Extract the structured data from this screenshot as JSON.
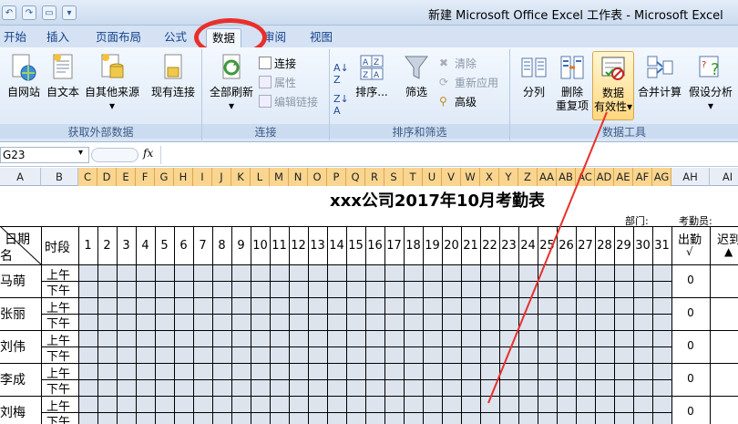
{
  "window": {
    "title": "新建 Microsoft Office Excel 工作表 - Microsoft Excel"
  },
  "tabs": [
    {
      "label": "开始",
      "active": false
    },
    {
      "label": "插入",
      "active": false
    },
    {
      "label": "页面布局",
      "active": false
    },
    {
      "label": "公式",
      "active": false
    },
    {
      "label": "数据",
      "active": true
    },
    {
      "label": "审阅",
      "active": false
    },
    {
      "label": "视图",
      "active": false
    }
  ],
  "ribbon": {
    "external": {
      "label": "获取外部数据",
      "web": "自网站",
      "text": "自文本",
      "other": "自其他来源",
      "existing": "现有连接"
    },
    "connections": {
      "label": "连接",
      "refresh_all": "全部刷新",
      "connections": "连接",
      "properties": "属性",
      "edit_links": "编辑链接"
    },
    "sort_filter": {
      "label": "排序和筛选",
      "sort": "排序...",
      "filter": "筛选",
      "clear": "清除",
      "reapply": "重新应用",
      "advanced": "高级"
    },
    "data_tools": {
      "label": "数据工具",
      "text_to_columns": "分列",
      "remove_dup_1": "删除",
      "remove_dup_2": "重复项",
      "validation_1": "数据",
      "validation_2": "有效性",
      "consolidate": "合并计算",
      "what_if": "假设分析"
    }
  },
  "formula_bar": {
    "name_box": "G23",
    "fx": "fx",
    "formula": ""
  },
  "columns": [
    "A",
    "B",
    "C",
    "D",
    "E",
    "F",
    "G",
    "H",
    "I",
    "J",
    "K",
    "L",
    "M",
    "N",
    "O",
    "P",
    "Q",
    "R",
    "S",
    "T",
    "U",
    "V",
    "W",
    "X",
    "Y",
    "Z",
    "AA",
    "AB",
    "AC",
    "AD",
    "AE",
    "AF",
    "AG",
    "AH",
    "AI"
  ],
  "sheet": {
    "title": "xxx公司2017年10月考勤表",
    "department_label": "部门:",
    "checker_label": "考勤员:",
    "header_date": "日期",
    "header_name": "名",
    "header_period": "时段",
    "days": [
      "1",
      "2",
      "3",
      "4",
      "5",
      "6",
      "7",
      "8",
      "9",
      "10",
      "11",
      "12",
      "13",
      "14",
      "15",
      "16",
      "17",
      "18",
      "19",
      "20",
      "21",
      "22",
      "23",
      "24",
      "25",
      "26",
      "27",
      "28",
      "29",
      "30",
      "31"
    ],
    "attendance_header": "出勤",
    "attendance_mark": "√",
    "late_header": "迟到",
    "late_mark": "▲",
    "am": "上午",
    "pm": "下午",
    "employees": [
      {
        "name": "马萌",
        "attendance": "0"
      },
      {
        "name": "张丽",
        "attendance": "0"
      },
      {
        "name": "刘伟",
        "attendance": "0"
      },
      {
        "name": "李成",
        "attendance": "0"
      },
      {
        "name": "刘梅",
        "attendance": "0"
      }
    ]
  },
  "colors": {
    "annotation": "#e8302b",
    "selected_header": "#f9d58f",
    "ribbon_bg": "#dbe7f6"
  }
}
